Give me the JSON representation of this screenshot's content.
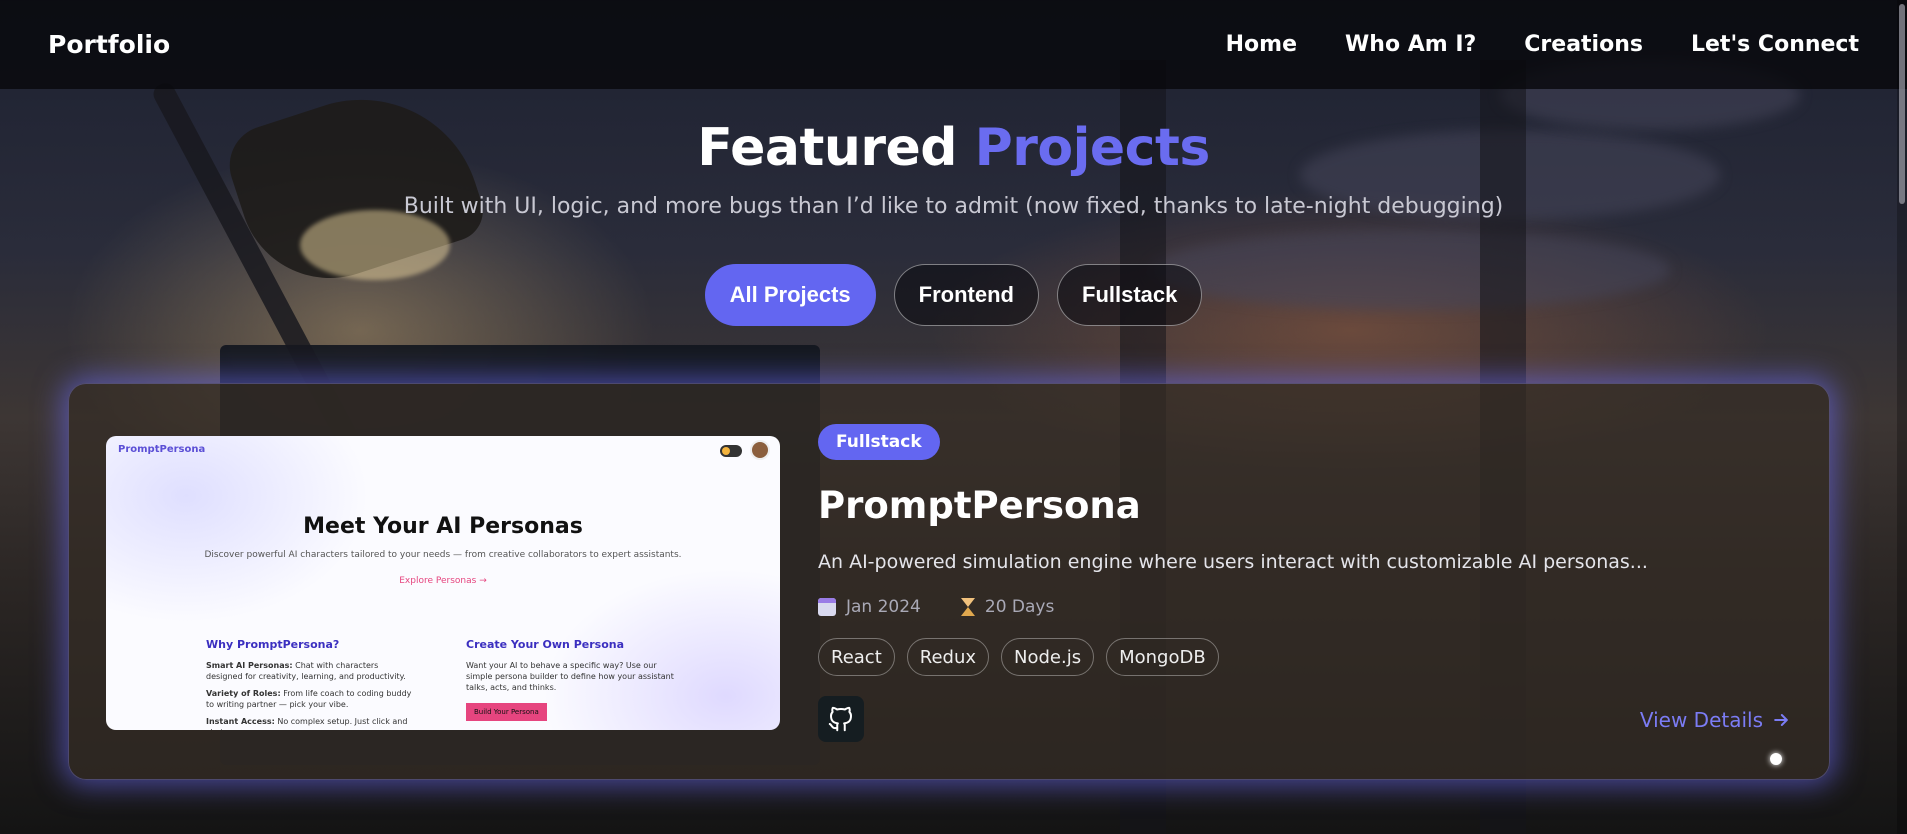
{
  "nav": {
    "brand": "Portfolio",
    "links": [
      "Home",
      "Who Am I?",
      "Creations",
      "Let's Connect"
    ]
  },
  "hero": {
    "title_main": "Featured",
    "title_accent": "Projects",
    "subtitle": "Built with UI, logic, and more bugs than I’d like to admit (now fixed, thanks to late-night debugging)"
  },
  "filters": {
    "items": [
      "All Projects",
      "Frontend",
      "Fullstack"
    ],
    "active": "All Projects"
  },
  "project": {
    "category": "Fullstack",
    "title": "PromptPersona",
    "description": "An AI-powered simulation engine where users interact with customizable AI personas...",
    "date": "Jan 2024",
    "duration": "20 Days",
    "tags": [
      "React",
      "Redux",
      "Node.js",
      "MongoDB"
    ],
    "view_details": "View Details",
    "screenshot": {
      "brand": "PromptPersona",
      "title": "Meet Your AI Personas",
      "description": "Discover powerful AI characters tailored to your needs — from creative collaborators to expert assistants.",
      "link": "Explore Personas →",
      "left_heading": "Why PromptPersona?",
      "left_items": [
        {
          "bold": "Smart AI Personas:",
          "text": "Chat with characters designed for creativity, learning, and productivity."
        },
        {
          "bold": "Variety of Roles:",
          "text": "From life coach to coding buddy to writing partner — pick your vibe."
        },
        {
          "bold": "Instant Access:",
          "text": "No complex setup. Just click and chat."
        }
      ],
      "right_heading": "Create Your Own Persona",
      "right_text": "Want your AI to behave a specific way? Use our simple persona builder to define how your assistant talks, acts, and thinks.",
      "right_button": "Build Your Persona"
    }
  },
  "colors": {
    "accent": "#6366f1",
    "accent_text": "#6a6cf0",
    "link": "#7b7cf4"
  },
  "icons": [
    "calendar-icon",
    "hourglass-icon",
    "github-icon",
    "arrow-right-icon"
  ]
}
